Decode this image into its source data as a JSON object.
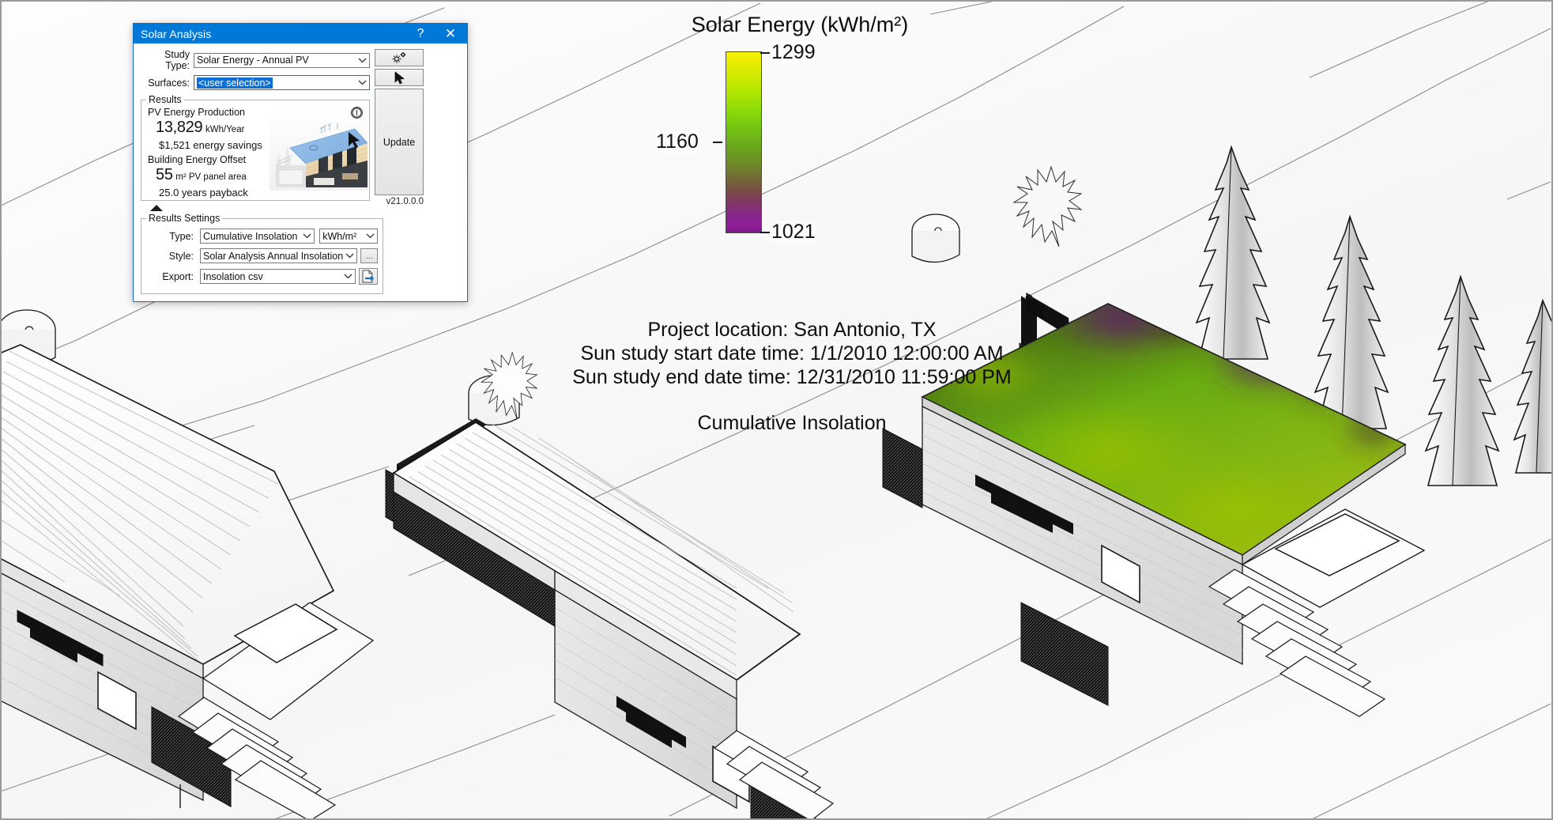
{
  "dialog": {
    "title": "Solar Analysis",
    "help_label": "?",
    "close_label": "✕",
    "study_type_label": "Study Type:",
    "study_type_value": "Solar Energy - Annual PV",
    "surfaces_label": "Surfaces:",
    "surfaces_value": "<user selection>",
    "settings_button_icon": "gear-icon",
    "select_button_icon": "cursor-arrow-icon",
    "update_label": "Update",
    "results_group_label": "Results",
    "pv_energy_production_label": "PV Energy Production",
    "pv_energy_value": "13,829",
    "pv_energy_unit": "kWh/Year",
    "energy_savings": "$1,521 energy savings",
    "building_energy_offset_label": "Building Energy Offset",
    "panel_area_value": "55",
    "panel_area_unit": "m² PV panel area",
    "payback": "25.0 years payback",
    "version": "v21.0.0.0",
    "results_settings_label": "Results Settings",
    "type_label": "Type:",
    "type_value": "Cumulative Insolation",
    "type_unit_value": "kWh/m²",
    "style_label": "Style:",
    "style_value": "Solar Analysis Annual Insolation",
    "style_browse_label": "...",
    "export_label": "Export:",
    "export_value": "Insolation csv",
    "export_button_icon": "export-file-icon",
    "info_icon_label": "ⓘ"
  },
  "legend": {
    "title": "Solar Energy (kWh/m²)",
    "max_label": "1299",
    "mid_label": "1160",
    "min_label": "1021"
  },
  "annotations": {
    "project_location": "Project location: San Antonio, TX",
    "sun_study_start": "Sun study start date time: 1/1/2010 12:00:00 AM",
    "sun_study_end": "Sun study end date time: 12/31/2010 11:59:00 PM",
    "result_type": "Cumulative Insolation"
  },
  "chart_data": {
    "type": "heatmap",
    "title": "Solar Energy (kWh/m²)",
    "subtitle": "Cumulative Insolation",
    "colorbar": {
      "min": 1021,
      "mid": 1160,
      "max": 1299,
      "unit": "kWh/m²",
      "ticks": [
        1021,
        1160,
        1299
      ],
      "colormap_stops": [
        "#7a1a85",
        "#87268a",
        "#7c4152",
        "#74623a",
        "#6f8a28",
        "#6aa81c",
        "#74c412",
        "#8ada0b",
        "#b9e800",
        "#f3f200"
      ],
      "orientation": "vertical"
    },
    "annotations": [
      "Project location: San Antonio, TX",
      "Sun study start date time: 1/1/2010 12:00:00 AM",
      "Sun study end date time: 12/31/2010 11:59:00 PM",
      "Cumulative Insolation"
    ],
    "surface_values": {
      "description": "Roof insolation surface of right-hand building",
      "low_regions_value": 1021,
      "high_regions_value": 1299,
      "dominant_value": 1190
    }
  },
  "scene": {
    "building_count": 3,
    "tree_count": 4,
    "analysis_surface": "roof-insolation-overlay"
  },
  "colors": {
    "accent": "#0078d7",
    "legend_max": "#f3f200",
    "legend_min": "#7a1a85",
    "dialog_border": "#0f6fbc"
  }
}
